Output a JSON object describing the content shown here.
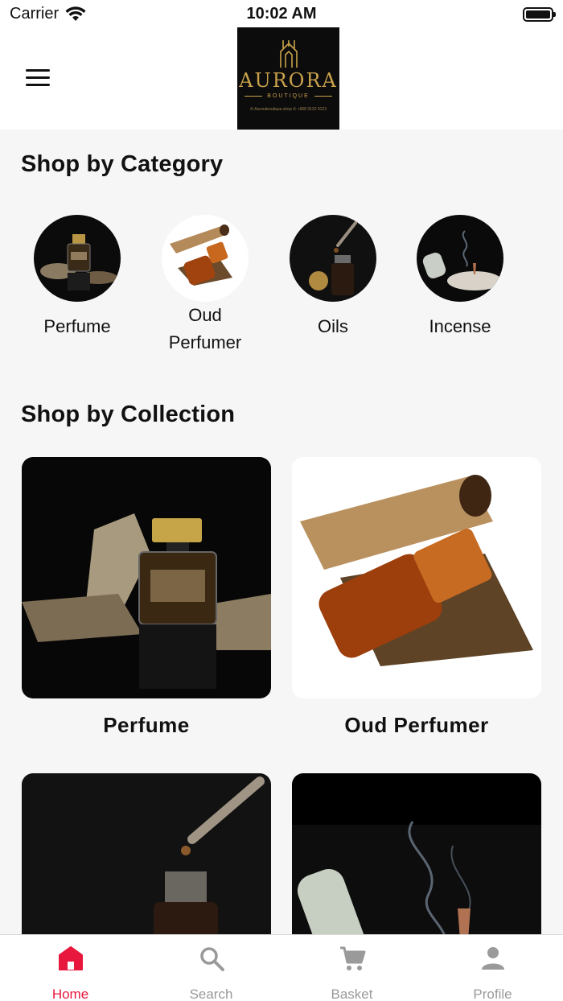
{
  "status_bar": {
    "carrier": "Carrier",
    "time": "10:02 AM"
  },
  "header": {
    "logo_text": "AURORA",
    "logo_subtext": "BOUTIQUE",
    "logo_contact": "✉ Auroraboutique.shop   ✆ +968 9132 9123"
  },
  "categories": {
    "title": "Shop by Category",
    "items": [
      {
        "label": "Perfume"
      },
      {
        "label": "Oud\nPerfumer"
      },
      {
        "label": "Oils"
      },
      {
        "label": "Incense"
      }
    ]
  },
  "collections": {
    "title": "Shop by Collection",
    "items": [
      {
        "label": "Perfume"
      },
      {
        "label": "Oud Perfumer"
      },
      {
        "label": ""
      },
      {
        "label": ""
      }
    ]
  },
  "tabs": [
    {
      "label": "Home",
      "icon": "home-icon",
      "active": true
    },
    {
      "label": "Search",
      "icon": "search-icon",
      "active": false
    },
    {
      "label": "Basket",
      "icon": "cart-icon",
      "active": false
    },
    {
      "label": "Profile",
      "icon": "profile-icon",
      "active": false
    }
  ],
  "colors": {
    "accent": "#e8173d",
    "inactive": "#9a9a9a",
    "logo_gold": "#c9a24b"
  }
}
